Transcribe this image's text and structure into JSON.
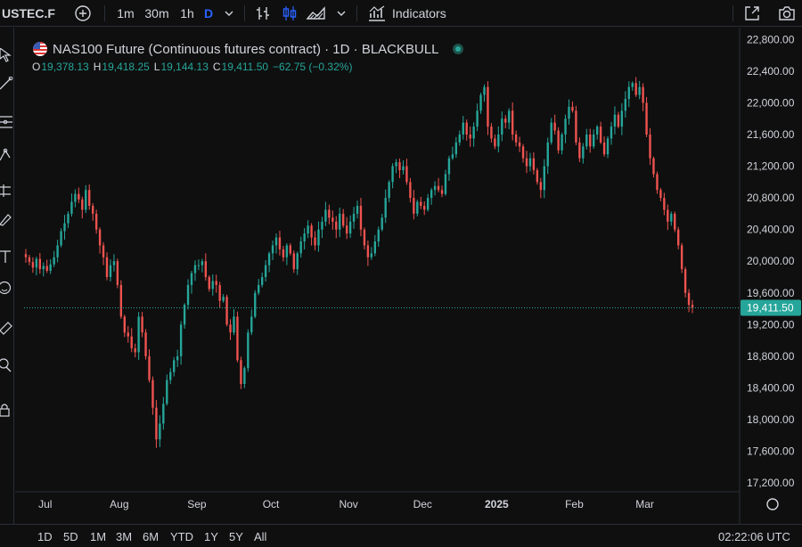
{
  "toolbar": {
    "symbol": "USTEC.F",
    "intervals": [
      "1m",
      "30m",
      "1h",
      "D"
    ],
    "active_interval": "D",
    "indicators_label": "Indicators"
  },
  "legend": {
    "title": "NAS100 Future (Continuous futures contract) · 1D · BLACKBULL",
    "open_label": "O",
    "open": "19,378.13",
    "high_label": "H",
    "high": "19,418.25",
    "low_label": "L",
    "low": "19,144.13",
    "close_label": "C",
    "close": "19,411.50",
    "change": "−62.75 (−0.32%)"
  },
  "price_scale": {
    "labels": [
      "22,800.00",
      "22,400.00",
      "22,000.00",
      "21,600.00",
      "21,200.00",
      "20,800.00",
      "20,400.00",
      "20,000.00",
      "19,600.00",
      "19,200.00",
      "18,800.00",
      "18,400.00",
      "18,000.00",
      "17,600.00",
      "17,200.00"
    ],
    "current_price_label": "19,411.50"
  },
  "time_scale": {
    "labels": [
      "Jul",
      "Aug",
      "Sep",
      "Oct",
      "Nov",
      "Dec",
      "2025",
      "Feb",
      "Mar"
    ]
  },
  "bottom": {
    "ranges": [
      "1D",
      "5D",
      "1M",
      "3M",
      "6M",
      "YTD",
      "1Y",
      "5Y",
      "All"
    ],
    "clock": "02:22:06 UTC"
  },
  "colors": {
    "up": "#26a69a",
    "down": "#ef5350",
    "background": "#0f0f0f",
    "accent": "#2962ff",
    "price_tag": "#26a69a"
  },
  "chart_data": {
    "type": "candlestick",
    "title": "NAS100 Future (Continuous futures contract) · 1D · BLACKBULL",
    "xlabel": "",
    "ylabel": "",
    "ylim": [
      17100,
      22950
    ],
    "x_ticks": [
      "Jul",
      "Aug",
      "Sep",
      "Oct",
      "Nov",
      "Dec",
      "2025",
      "Feb",
      "Mar"
    ],
    "last_close": 19411.5,
    "grid": false,
    "closes": [
      20050,
      19990,
      19920,
      20030,
      19900,
      19940,
      19880,
      19960,
      20050,
      20200,
      20380,
      20480,
      20600,
      20750,
      20850,
      20780,
      20650,
      20900,
      20700,
      20600,
      20400,
      20200,
      20050,
      19800,
      19950,
      20000,
      19700,
      19300,
      19100,
      19050,
      18900,
      18850,
      19300,
      19100,
      18800,
      18500,
      18150,
      17750,
      17950,
      18200,
      18500,
      18600,
      18750,
      18800,
      19200,
      19450,
      19700,
      19850,
      19950,
      19950,
      20000,
      19800,
      19650,
      19750,
      19700,
      19500,
      19550,
      19200,
      19100,
      19300,
      18750,
      18450,
      18650,
      19100,
      19300,
      19600,
      19700,
      19800,
      19950,
      20100,
      20200,
      20300,
      20150,
      20050,
      20200,
      20100,
      19900,
      20100,
      20250,
      20350,
      20450,
      20300,
      20200,
      20400,
      20500,
      20650,
      20550,
      20500,
      20400,
      20600,
      20450,
      20350,
      20500,
      20600,
      20700,
      20400,
      20200,
      20050,
      20100,
      20250,
      20400,
      20550,
      20800,
      21000,
      21200,
      21250,
      21150,
      21200,
      21000,
      20800,
      20600,
      20750,
      20700,
      20650,
      20800,
      20900,
      20950,
      20900,
      20850,
      21100,
      21300,
      21350,
      21500,
      21600,
      21750,
      21600,
      21550,
      21700,
      21900,
      22100,
      22200,
      21700,
      21550,
      21450,
      21600,
      21800,
      21750,
      21900,
      21600,
      21500,
      21450,
      21300,
      21200,
      21300,
      21150,
      21000,
      20900,
      21200,
      21500,
      21750,
      21650,
      21400,
      21600,
      21800,
      21950,
      21900,
      21500,
      21300,
      21450,
      21600,
      21450,
      21600,
      21700,
      21500,
      21350,
      21550,
      21700,
      21850,
      21700,
      21900,
      22050,
      22200,
      22250,
      22100,
      22200,
      22000,
      21600,
      21300,
      21100,
      20900,
      20800,
      20650,
      20500,
      20600,
      20400,
      20200,
      19900,
      19600,
      19450,
      19411.5
    ]
  }
}
